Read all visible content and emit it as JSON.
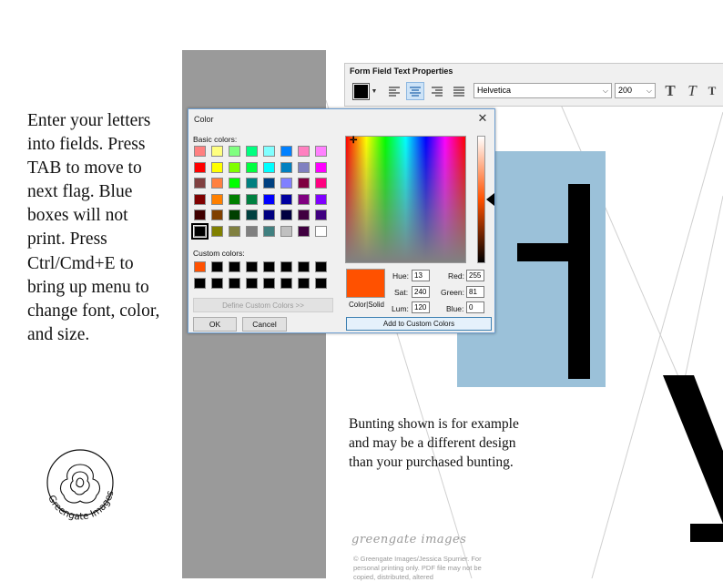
{
  "instructions": {
    "text": "Enter your letters into fields. Press TAB to move to next flag. Blue boxes will not print. Press Ctrl/Cmd+E to bring up menu to change font, color, and size."
  },
  "logo": {
    "text": "Greengate Images",
    "icon": "flower-icon"
  },
  "bunting_note": "Bunting shown is for example and may be a different design than your purchased bunting.",
  "brand_script": "greengate images",
  "copyright": "© Greengate Images/Jessica Spurrier. For personal printing only. PDF file may not be copied, distributed, altered",
  "toolbar": {
    "title": "Form Field Text Properties",
    "text_color": "#000000",
    "font": "Helvetica",
    "size": "200",
    "buttons": [
      "align-left",
      "align-center",
      "align-right",
      "justify",
      "text-bold",
      "text-italic",
      "text-underline-small"
    ],
    "selected_alignment": "center",
    "t_label": "T"
  },
  "color_dialog": {
    "title": "Color",
    "close_label": "✕",
    "basic_colors_label": "Basic colors:",
    "custom_colors_label": "Custom colors:",
    "basic_colors": [
      "#ff8080",
      "#ffff80",
      "#80ff80",
      "#00ff80",
      "#80ffff",
      "#0080ff",
      "#ff80c0",
      "#ff80ff",
      "#ff0000",
      "#ffff00",
      "#80ff00",
      "#00ff40",
      "#00ffff",
      "#0080c0",
      "#8080c0",
      "#ff00ff",
      "#804040",
      "#ff8040",
      "#00ff00",
      "#008080",
      "#004080",
      "#8080ff",
      "#800040",
      "#ff0080",
      "#800000",
      "#ff8000",
      "#008000",
      "#008040",
      "#0000ff",
      "#0000a0",
      "#800080",
      "#8000ff",
      "#400000",
      "#804000",
      "#004000",
      "#004040",
      "#000080",
      "#000040",
      "#400040",
      "#400080",
      "#000000",
      "#808000",
      "#808040",
      "#808080",
      "#408080",
      "#c0c0c0",
      "#400040",
      "#ffffff"
    ],
    "selected_basic_index": 40,
    "custom_colors": [
      "#ff5100",
      "#000000",
      "#000000",
      "#000000",
      "#000000",
      "#000000",
      "#000000",
      "#000000",
      "#000000",
      "#000000",
      "#000000",
      "#000000",
      "#000000",
      "#000000",
      "#000000",
      "#000000"
    ],
    "define_custom_label": "Define Custom Colors >>",
    "ok_label": "OK",
    "cancel_label": "Cancel",
    "color_solid_label": "Color|Solid",
    "preview_color": "#ff5100",
    "hue_label": "Hue:",
    "hue": "13",
    "sat_label": "Sat:",
    "sat": "240",
    "lum_label": "Lum:",
    "lum": "120",
    "red_label": "Red:",
    "red": "255",
    "green_label": "Green:",
    "green": "81",
    "blue_label": "Blue:",
    "blue": "0",
    "add_custom_label": "Add to Custom Colors"
  },
  "colors": {
    "blue_box": "#9bc1d9",
    "gray_strip": "#9a9a9a",
    "accent_border": "#6d9fd2"
  }
}
